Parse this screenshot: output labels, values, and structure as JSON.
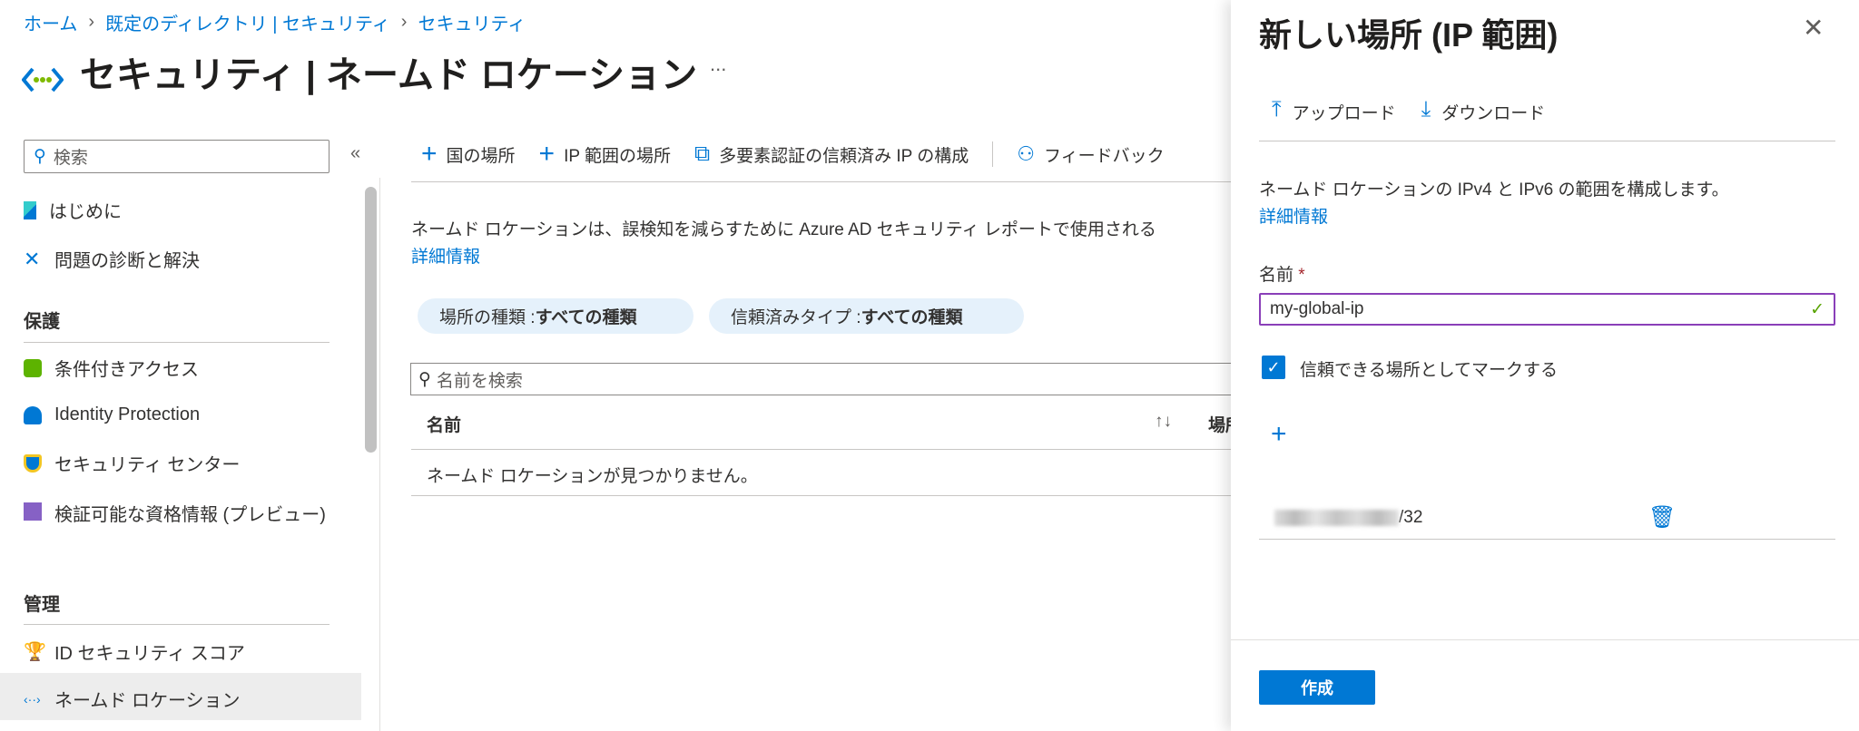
{
  "breadcrumb": [
    "ホーム",
    "既定のディレクトリ | セキュリティ",
    "セキュリティ"
  ],
  "page_title": "セキュリティ | ネームド ロケーション",
  "more_label": "...",
  "sidebar": {
    "search_placeholder": "検索",
    "collapse": "«",
    "items": [
      "はじめに",
      "問題の診断と解決"
    ],
    "sections": [
      {
        "title": "保護",
        "items": [
          "条件付きアクセス",
          "Identity Protection",
          "セキュリティ センター",
          "検証可能な資格情報 (プレビュー)"
        ]
      },
      {
        "title": "管理",
        "items": [
          "ID セキュリティ スコア",
          "ネームド ロケーション"
        ]
      }
    ]
  },
  "toolbar": {
    "country": "国の場所",
    "ip_range": "IP 範囲の場所",
    "mfa": "多要素認証の信頼済み IP の構成",
    "feedback": "フィードバック"
  },
  "main": {
    "description": "ネームド ロケーションは、誤検知を減らすために Azure AD セキュリティ レポートで使用される",
    "learn_more": "詳細情報",
    "filters": [
      {
        "label": "場所の種類 : ",
        "value": "すべての種類"
      },
      {
        "label": "信頼済みタイプ : ",
        "value": "すべての種類"
      }
    ],
    "search_placeholder": "名前を検索",
    "columns": [
      "名前",
      "場所"
    ],
    "empty": "ネームド ロケーションが見つかりません。"
  },
  "panel": {
    "title": "新しい場所 (IP 範囲)",
    "upload": "アップロード",
    "download": "ダウンロード",
    "description": "ネームド ロケーションの IPv4 と IPv6 の範囲を構成します。",
    "learn_more": "詳細情報",
    "name_label": "名前",
    "required": "*",
    "name_value": "my-global-ip",
    "trusted_label": "信頼できる場所としてマークする",
    "trusted_checked": true,
    "ip_suffix": "/32",
    "create": "作成"
  }
}
